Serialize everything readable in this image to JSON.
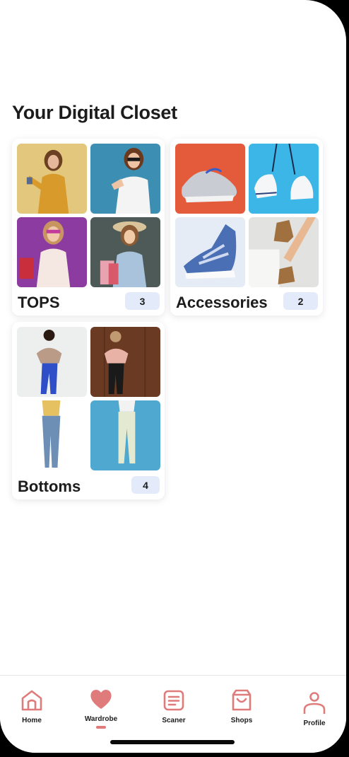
{
  "page": {
    "title": "Your Digital Closet"
  },
  "colors": {
    "accent": "#e07b7b",
    "count_badge": "#e3ebfb",
    "text": "#1c1c1c"
  },
  "categories": [
    {
      "label": "TOPS",
      "count": "3",
      "images": [
        "woman-mustard-dress",
        "woman-thumbs-up",
        "woman-shopping-bags-purple",
        "woman-shopping-bags-hat"
      ]
    },
    {
      "label": "Accessories",
      "count": "2",
      "images": [
        "sneaker-grey",
        "sneakers-hanging",
        "slip-on-shoe-blue",
        "ankle-boots-tan"
      ]
    },
    {
      "label": "Bottoms",
      "count": "4",
      "images": [
        "woman-blue-jeans",
        "woman-dark-pants",
        "woman-light-jeans",
        "woman-cream-pants"
      ]
    }
  ],
  "tabbar": {
    "items": [
      {
        "label": "Home",
        "icon": "home-icon"
      },
      {
        "label": "Wardrobe",
        "icon": "heart-icon",
        "active": true
      },
      {
        "label": "Scaner",
        "icon": "document-icon"
      },
      {
        "label": "Shops",
        "icon": "shopping-bag-icon"
      },
      {
        "label": "Profile",
        "icon": "person-icon"
      }
    ]
  }
}
